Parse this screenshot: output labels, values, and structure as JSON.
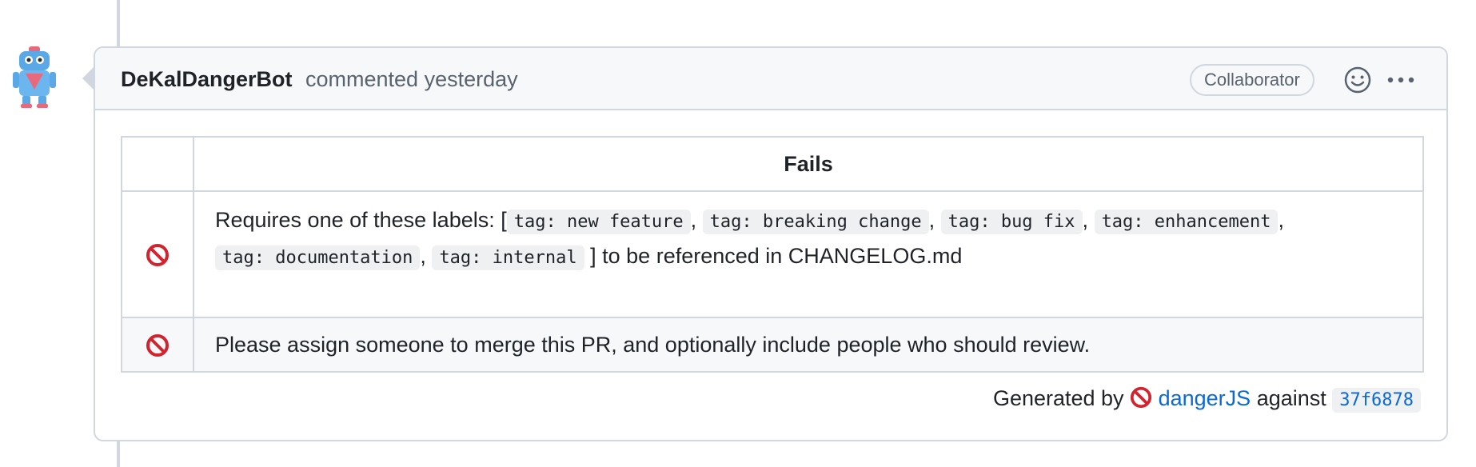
{
  "comment": {
    "author": "DeKalDangerBot",
    "action": "commented yesterday",
    "role": "Collaborator"
  },
  "table": {
    "header": "Fails",
    "rows": [
      {
        "icon": "no-entry-icon",
        "text_before": "Requires one of these labels: [",
        "labels": [
          "tag: new feature",
          "tag: breaking change",
          "tag: bug fix",
          "tag: enhancement",
          "tag: documentation",
          "tag: internal"
        ],
        "text_after": "] to be referenced in CHANGELOG.md"
      },
      {
        "icon": "no-entry-icon",
        "text": "Please assign someone to merge this PR, and optionally include people who should review."
      }
    ]
  },
  "footer": {
    "prefix": "Generated by",
    "link": "dangerJS",
    "middle": "against",
    "commit": "37f6878"
  },
  "colors": {
    "link": "#0969da",
    "border": "#d0d7de",
    "header_bg": "#f6f8fa",
    "no_entry": "#d1242f"
  }
}
